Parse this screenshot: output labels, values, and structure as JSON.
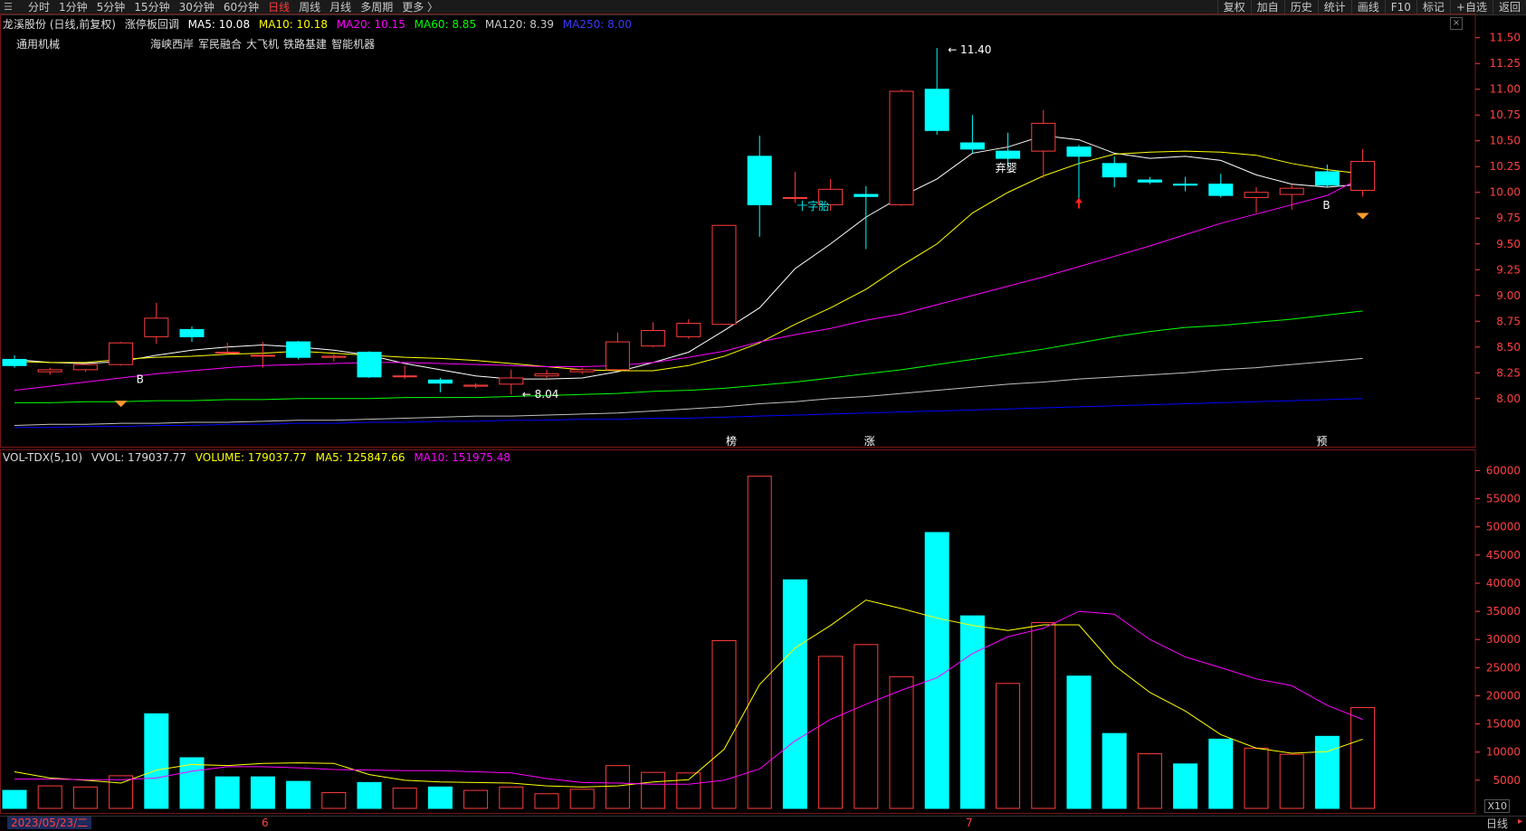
{
  "toolbar": {
    "tabs": [
      {
        "label": "分时",
        "active": false
      },
      {
        "label": "1分钟",
        "active": false
      },
      {
        "label": "5分钟",
        "active": false
      },
      {
        "label": "15分钟",
        "active": false
      },
      {
        "label": "30分钟",
        "active": false
      },
      {
        "label": "60分钟",
        "active": false
      },
      {
        "label": "日线",
        "active": true
      },
      {
        "label": "周线",
        "active": false
      },
      {
        "label": "月线",
        "active": false
      },
      {
        "label": "多周期",
        "active": false
      },
      {
        "label": "更多 〉",
        "active": false
      }
    ],
    "right_buttons": [
      "复权",
      "加自",
      "历史",
      "统计",
      "画线",
      "F10",
      "标记",
      "+自选",
      "返回"
    ]
  },
  "legend": {
    "title": "龙溪股份 (日线,前复权)",
    "indicator": "涨停板回调",
    "ma5": "MA5: 10.08",
    "ma10": "MA10: 10.18",
    "ma20": "MA20: 10.15",
    "ma60": "MA60: 8.85",
    "ma120": "MA120: 8.39",
    "ma250": "MA250: 8.00"
  },
  "sector": "通用机械",
  "concepts": [
    "海峡西岸",
    "军民融合",
    "大飞机",
    "铁路基建",
    "智能机器"
  ],
  "vol_legend": {
    "name": "VOL-TDX(5,10)",
    "vvol": "VVOL: 179037.77",
    "volume": "VOLUME: 179037.77",
    "ma5": "MA5: 125847.66",
    "ma10": "MA10: 151975.48"
  },
  "colors": {
    "up": "#ff3c3c",
    "down": "#00ffff",
    "ma5": "#ffffff",
    "ma10": "#ffff00",
    "ma20": "#ff00ff",
    "ma60": "#00ff00",
    "ma120": "#c0c0c0",
    "ma250": "#0000ff",
    "grid": "#7a1616",
    "axis": "#ff4040"
  },
  "annotations": {
    "high": "11.40",
    "low": "8.04",
    "b1": "B",
    "b2": "B",
    "shizixing": "十字胎",
    "qiying": "弃婴",
    "bang": "榜",
    "zhang": "涨",
    "yu": "预"
  },
  "footer": {
    "date": "2023/05/23/二",
    "month6": "6",
    "month7": "7",
    "period": "日线",
    "zoom": "X10"
  },
  "chart_data": [
    {
      "type": "candlestick",
      "title": "龙溪股份 (日线,前复权)",
      "ylim": [
        7.7,
        11.55
      ],
      "y_ticks": [
        8.0,
        8.25,
        8.5,
        8.75,
        9.0,
        9.25,
        9.5,
        9.75,
        10.0,
        10.25,
        10.5,
        10.75,
        11.0,
        11.25,
        11.5
      ],
      "candles": [
        {
          "o": 8.38,
          "h": 8.42,
          "l": 8.3,
          "c": 8.32
        },
        {
          "o": 8.26,
          "h": 8.3,
          "l": 8.23,
          "c": 8.28
        },
        {
          "o": 8.28,
          "h": 8.34,
          "l": 8.26,
          "c": 8.33
        },
        {
          "o": 8.33,
          "h": 8.55,
          "l": 8.32,
          "c": 8.54
        },
        {
          "o": 8.6,
          "h": 8.93,
          "l": 8.53,
          "c": 8.78
        },
        {
          "o": 8.67,
          "h": 8.7,
          "l": 8.55,
          "c": 8.6
        },
        {
          "o": 8.45,
          "h": 8.54,
          "l": 8.44,
          "c": 8.45
        },
        {
          "o": 8.42,
          "h": 8.55,
          "l": 8.3,
          "c": 8.42
        },
        {
          "o": 8.55,
          "h": 8.56,
          "l": 8.38,
          "c": 8.4
        },
        {
          "o": 8.4,
          "h": 8.43,
          "l": 8.36,
          "c": 8.41
        },
        {
          "o": 8.45,
          "h": 8.46,
          "l": 8.2,
          "c": 8.21
        },
        {
          "o": 8.22,
          "h": 8.32,
          "l": 8.19,
          "c": 8.22
        },
        {
          "o": 8.18,
          "h": 8.2,
          "l": 8.06,
          "c": 8.15
        },
        {
          "o": 8.12,
          "h": 8.15,
          "l": 8.1,
          "c": 8.13
        },
        {
          "o": 8.14,
          "h": 8.28,
          "l": 8.04,
          "c": 8.2
        },
        {
          "o": 8.22,
          "h": 8.28,
          "l": 8.2,
          "c": 8.24
        },
        {
          "o": 8.26,
          "h": 8.3,
          "l": 8.24,
          "c": 8.28
        },
        {
          "o": 8.28,
          "h": 8.64,
          "l": 8.27,
          "c": 8.55
        },
        {
          "o": 8.51,
          "h": 8.74,
          "l": 8.5,
          "c": 8.66
        },
        {
          "o": 8.6,
          "h": 8.77,
          "l": 8.58,
          "c": 8.73
        },
        {
          "o": 8.72,
          "h": 9.68,
          "l": 8.72,
          "c": 9.68
        },
        {
          "o": 10.35,
          "h": 10.55,
          "l": 9.57,
          "c": 9.88
        },
        {
          "o": 9.95,
          "h": 10.2,
          "l": 9.9,
          "c": 9.95
        },
        {
          "o": 9.88,
          "h": 10.13,
          "l": 9.82,
          "c": 10.03
        },
        {
          "o": 9.98,
          "h": 10.06,
          "l": 9.45,
          "c": 9.96
        },
        {
          "o": 9.88,
          "h": 11.0,
          "l": 9.87,
          "c": 10.98
        },
        {
          "o": 11.0,
          "h": 11.4,
          "l": 10.56,
          "c": 10.6
        },
        {
          "o": 10.48,
          "h": 10.75,
          "l": 10.38,
          "c": 10.42
        },
        {
          "o": 10.4,
          "h": 10.58,
          "l": 10.25,
          "c": 10.33
        },
        {
          "o": 10.4,
          "h": 10.8,
          "l": 10.14,
          "c": 10.67
        },
        {
          "o": 10.44,
          "h": 10.46,
          "l": 9.9,
          "c": 10.35
        },
        {
          "o": 10.28,
          "h": 10.35,
          "l": 10.05,
          "c": 10.15
        },
        {
          "o": 10.12,
          "h": 10.15,
          "l": 10.08,
          "c": 10.1
        },
        {
          "o": 10.08,
          "h": 10.15,
          "l": 10.01,
          "c": 10.07
        },
        {
          "o": 10.08,
          "h": 10.18,
          "l": 9.95,
          "c": 9.97
        },
        {
          "o": 9.95,
          "h": 10.05,
          "l": 9.8,
          "c": 10.0
        },
        {
          "o": 9.98,
          "h": 10.08,
          "l": 9.83,
          "c": 10.04
        },
        {
          "o": 10.2,
          "h": 10.27,
          "l": 10.05,
          "c": 10.07
        },
        {
          "o": 10.02,
          "h": 10.42,
          "l": 9.96,
          "c": 10.3
        }
      ],
      "series": [
        {
          "name": "MA5",
          "values": [
            8.38,
            8.35,
            8.34,
            8.36,
            8.42,
            8.47,
            8.5,
            8.52,
            8.5,
            8.47,
            8.42,
            8.34,
            8.28,
            8.22,
            8.19,
            8.19,
            8.2,
            8.26,
            8.35,
            8.45,
            8.66,
            8.88,
            9.26,
            9.5,
            9.76,
            9.96,
            10.13,
            10.38,
            10.44,
            10.55,
            10.51,
            10.38,
            10.33,
            10.35,
            10.31,
            10.17,
            10.08,
            10.05,
            10.08
          ]
        },
        {
          "name": "MA10",
          "values": [
            8.36,
            8.35,
            8.35,
            8.38,
            8.4,
            8.41,
            8.43,
            8.44,
            8.46,
            8.44,
            8.42,
            8.4,
            8.39,
            8.37,
            8.34,
            8.31,
            8.28,
            8.27,
            8.27,
            8.32,
            8.41,
            8.54,
            8.72,
            8.88,
            9.06,
            9.29,
            9.5,
            9.8,
            10.0,
            10.16,
            10.28,
            10.37,
            10.39,
            10.4,
            10.39,
            10.36,
            10.28,
            10.22,
            10.18
          ]
        },
        {
          "name": "MA20",
          "values": [
            8.08,
            8.12,
            8.16,
            8.2,
            8.24,
            8.27,
            8.3,
            8.32,
            8.33,
            8.34,
            8.35,
            8.35,
            8.34,
            8.33,
            8.32,
            8.31,
            8.31,
            8.32,
            8.35,
            8.4,
            8.46,
            8.55,
            8.62,
            8.68,
            8.76,
            8.82,
            8.91,
            9.0,
            9.09,
            9.18,
            9.28,
            9.38,
            9.48,
            9.59,
            9.7,
            9.79,
            9.88,
            9.97,
            10.15
          ]
        },
        {
          "name": "MA60",
          "values": [
            7.96,
            7.96,
            7.97,
            7.97,
            7.98,
            7.98,
            7.99,
            7.99,
            8.0,
            8.0,
            8.0,
            8.01,
            8.01,
            8.01,
            8.02,
            8.03,
            8.04,
            8.05,
            8.07,
            8.08,
            8.1,
            8.13,
            8.16,
            8.2,
            8.24,
            8.28,
            8.33,
            8.38,
            8.43,
            8.48,
            8.54,
            8.6,
            8.65,
            8.69,
            8.71,
            8.74,
            8.77,
            8.81,
            8.85
          ]
        },
        {
          "name": "MA120",
          "values": [
            7.74,
            7.75,
            7.75,
            7.76,
            7.76,
            7.77,
            7.77,
            7.78,
            7.79,
            7.79,
            7.8,
            7.81,
            7.82,
            7.83,
            7.83,
            7.84,
            7.85,
            7.86,
            7.88,
            7.9,
            7.92,
            7.95,
            7.97,
            8.0,
            8.02,
            8.05,
            8.08,
            8.11,
            8.14,
            8.16,
            8.19,
            8.21,
            8.23,
            8.25,
            8.28,
            8.3,
            8.33,
            8.36,
            8.39
          ]
        },
        {
          "name": "MA250",
          "values": [
            7.72,
            7.72,
            7.73,
            7.73,
            7.74,
            7.74,
            7.75,
            7.75,
            7.76,
            7.76,
            7.77,
            7.77,
            7.78,
            7.78,
            7.79,
            7.79,
            7.8,
            7.8,
            7.81,
            7.81,
            7.82,
            7.83,
            7.84,
            7.85,
            7.86,
            7.87,
            7.88,
            7.89,
            7.9,
            7.91,
            7.92,
            7.93,
            7.94,
            7.95,
            7.96,
            7.97,
            7.98,
            7.99,
            8.0
          ]
        }
      ]
    },
    {
      "type": "bar",
      "title": "VOL-TDX(5,10)",
      "ylim": [
        0,
        62000
      ],
      "y_ticks": [
        5000,
        10000,
        15000,
        20000,
        25000,
        30000,
        35000,
        40000,
        45000,
        50000,
        55000,
        60000
      ],
      "values": [
        3200,
        4000,
        3800,
        5800,
        16800,
        9000,
        5600,
        5600,
        4800,
        2800,
        4600,
        3600,
        3800,
        3200,
        3800,
        2600,
        3400,
        7600,
        6400,
        6300,
        29800,
        59000,
        40600,
        27000,
        29100,
        23400,
        49000,
        34200,
        22200,
        33000,
        23500,
        13300,
        9700,
        7900,
        12300,
        10700,
        9600,
        12800,
        17900
      ],
      "up": [
        false,
        true,
        true,
        true,
        false,
        false,
        false,
        false,
        false,
        true,
        false,
        true,
        false,
        true,
        true,
        true,
        true,
        true,
        true,
        true,
        true,
        true,
        false,
        true,
        true,
        true,
        false,
        false,
        true,
        true,
        false,
        false,
        true,
        false,
        false,
        true,
        true,
        false,
        true
      ],
      "series": [
        {
          "name": "MA5",
          "values": [
            6500,
            5400,
            5000,
            4500,
            6800,
            7800,
            7600,
            8000,
            8100,
            8000,
            6000,
            5000,
            4700,
            4600,
            4500,
            4000,
            3800,
            4000,
            4700,
            5100,
            10500,
            22000,
            28500,
            32500,
            37000,
            35500,
            33800,
            32500,
            31600,
            32600,
            32600,
            25400,
            20600,
            17300,
            13100,
            10700,
            9800,
            10100,
            12300
          ]
        },
        {
          "name": "MA10",
          "values": [
            5200,
            5200,
            5100,
            5100,
            5400,
            6600,
            7400,
            7400,
            7200,
            6900,
            6800,
            6700,
            6700,
            6500,
            6300,
            5300,
            4600,
            4500,
            4300,
            4300,
            5000,
            7000,
            12000,
            15800,
            18500,
            21000,
            23200,
            27500,
            30500,
            32000,
            35000,
            34500,
            30000,
            26900,
            25000,
            23000,
            21800,
            18300,
            15800,
            15200
          ]
        }
      ]
    }
  ]
}
